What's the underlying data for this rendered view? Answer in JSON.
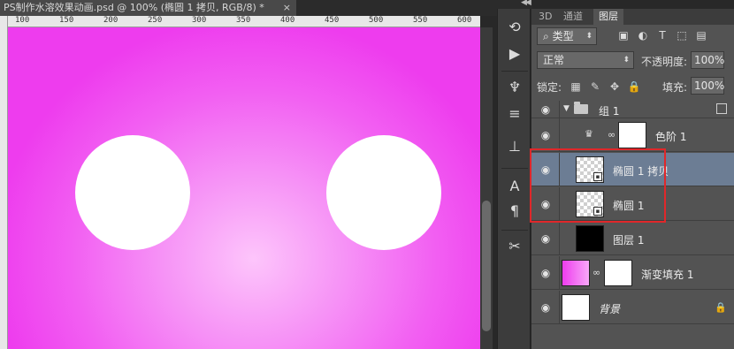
{
  "document": {
    "tab_title": "PS制作水溶效果动画.psd @ 100% (椭圆 1 拷贝, RGB/8) *",
    "close_glyph": "×"
  },
  "ruler": {
    "h_ticks": [
      "100",
      "150",
      "200",
      "250",
      "300",
      "350",
      "400",
      "450",
      "500",
      "550",
      "600"
    ]
  },
  "panel": {
    "tabs": [
      "3D",
      "通道",
      "图层"
    ],
    "active_tab": "图层",
    "filter_kind": "类型",
    "blend_mode": "正常",
    "opacity_label": "不透明度:",
    "opacity_value": "100%",
    "lock_label": "锁定:",
    "fill_label": "填充:",
    "fill_value": "100%"
  },
  "layers": [
    {
      "name": "组 1",
      "type": "group"
    },
    {
      "name": "色阶 1",
      "type": "adjustment"
    },
    {
      "name": "椭圆 1 拷贝",
      "type": "smart",
      "selected": true
    },
    {
      "name": "椭圆 1",
      "type": "smart"
    },
    {
      "name": "图层 1",
      "type": "pixel"
    },
    {
      "name": "渐变填充 1",
      "type": "fill"
    },
    {
      "name": "背景",
      "type": "background"
    }
  ],
  "colors": {
    "canvas_edge": "#ee3cee",
    "canvas_center": "#fdc5fb",
    "selected_row": "#6c7d94",
    "highlight_box": "#e0272a"
  },
  "icons": {
    "eye": "eye-icon",
    "lock": "lock-icon",
    "chain": "link-icon",
    "folder": "folder-icon"
  }
}
